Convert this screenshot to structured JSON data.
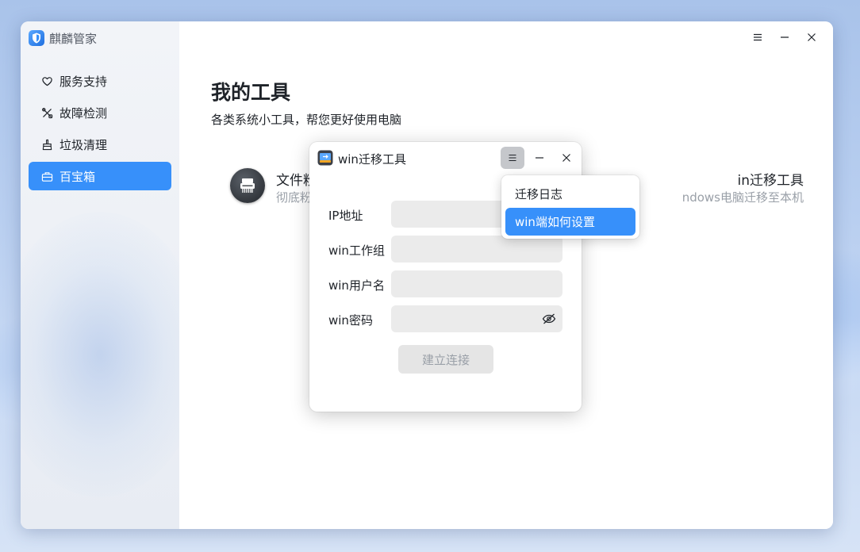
{
  "app": {
    "name": "麒麟管家"
  },
  "sidebar": {
    "items": [
      {
        "label": "服务支持",
        "icon": "heart-icon",
        "active": false
      },
      {
        "label": "故障检测",
        "icon": "tools-icon",
        "active": false
      },
      {
        "label": "垃圾清理",
        "icon": "broom-icon",
        "active": false
      },
      {
        "label": "百宝箱",
        "icon": "toolbox-icon",
        "active": true
      }
    ]
  },
  "main": {
    "title": "我的工具",
    "subtitle": "各类系统小工具，帮您更好使用电脑",
    "tools": [
      {
        "name": "文件粉碎",
        "description": "彻底粉碎文件",
        "icon": "shredder-icon"
      },
      {
        "name": "in迁移工具",
        "description": "ndows电脑迁移至本机"
      }
    ]
  },
  "dialog": {
    "title": "win迁移工具",
    "fields": [
      {
        "label": "IP地址",
        "value": ""
      },
      {
        "label": "win工作组",
        "value": ""
      },
      {
        "label": "win用户名",
        "value": ""
      },
      {
        "label": "win密码",
        "value": ""
      }
    ],
    "connect_label": "建立连接"
  },
  "menu": {
    "items": [
      {
        "label": "迁移日志",
        "highlighted": false
      },
      {
        "label": "win端如何设置",
        "highlighted": true
      }
    ]
  },
  "colors": {
    "accent": "#3790fa",
    "sidebar_bg": "#eef1f6",
    "input_bg": "#ebebeb",
    "disabled_text": "#9aa0a8"
  }
}
